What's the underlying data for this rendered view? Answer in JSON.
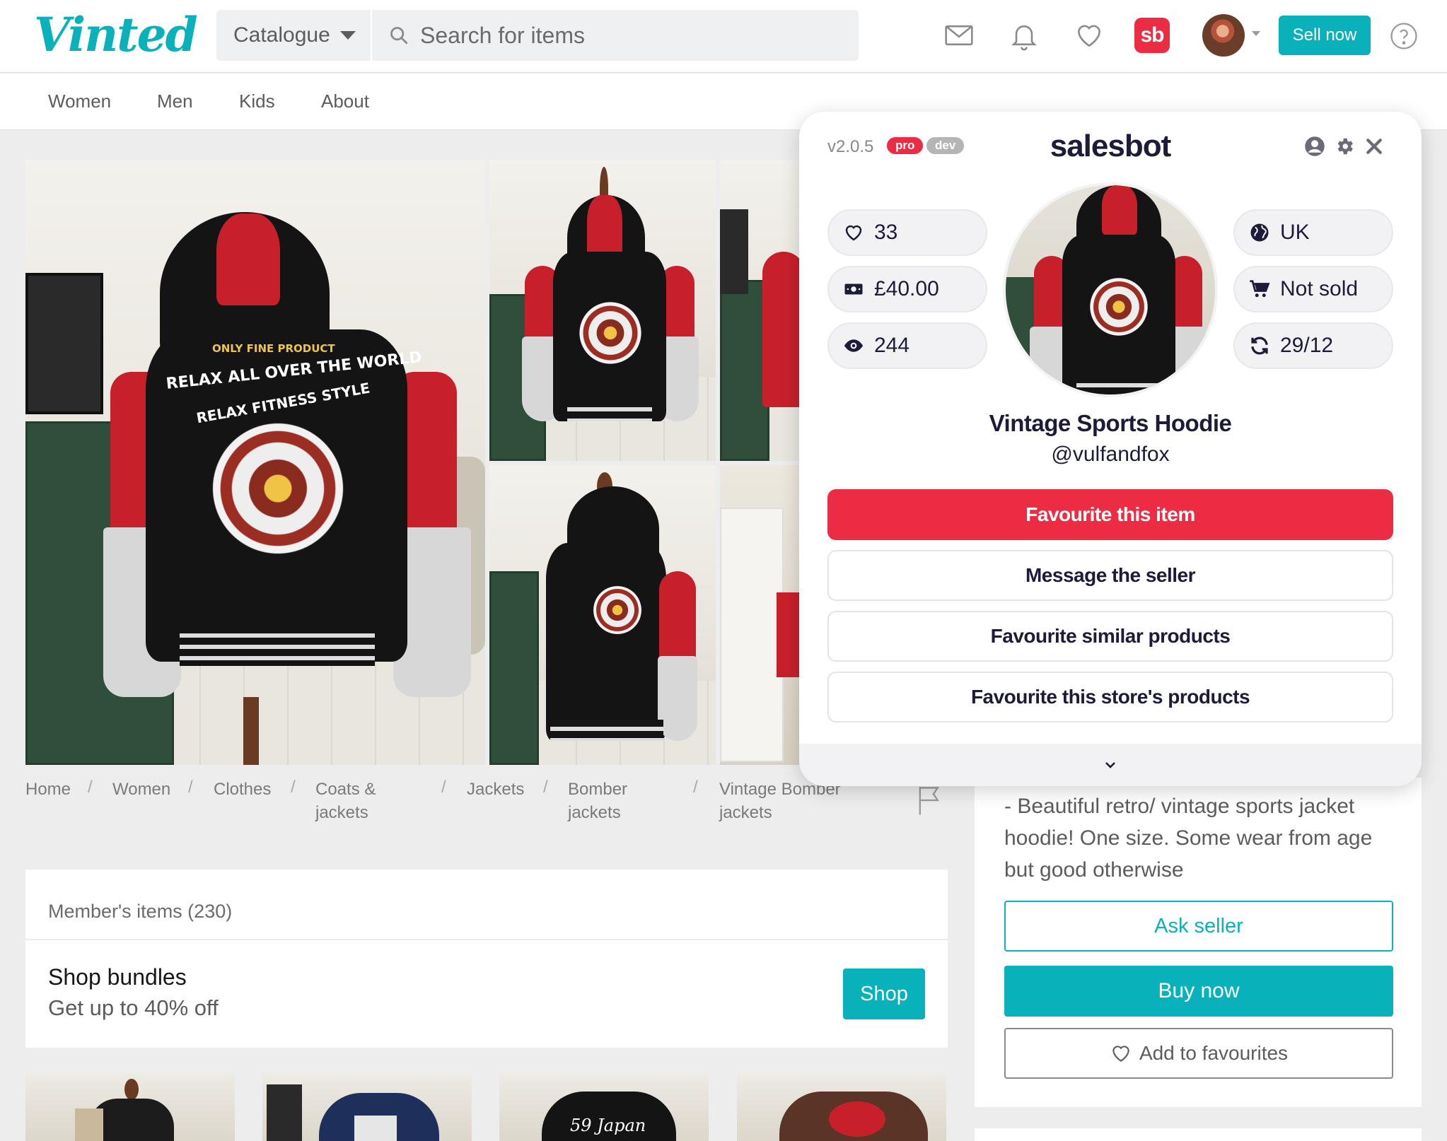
{
  "header": {
    "logo": "Vinted",
    "catalogue_label": "Catalogue",
    "search_placeholder": "Search for items",
    "icons": [
      "mail-icon",
      "bell-icon",
      "heart-icon",
      "salesbot-icon",
      "avatar",
      "help-icon"
    ],
    "salesbot_badge": "sb",
    "sell_label": "Sell now"
  },
  "nav": {
    "items": [
      "Women",
      "Men",
      "Kids",
      "About"
    ]
  },
  "breadcrumb": [
    {
      "line1": "Home",
      "line2": ""
    },
    {
      "line1": "Women",
      "line2": ""
    },
    {
      "line1": "Clothes",
      "line2": ""
    },
    {
      "line1": "Coats &",
      "line2": "jackets"
    },
    {
      "line1": "Jackets",
      "line2": ""
    },
    {
      "line1": "Bomber",
      "line2": "jackets"
    },
    {
      "line1": "Vintage Bomber",
      "line2": "jackets"
    }
  ],
  "product_print": {
    "line1": "ONLY FINE PRODUCT",
    "line2": "RELAX ALL OVER THE WORLD",
    "line3": "RELAX FITNESS STYLE"
  },
  "members": {
    "title": "Member's items (230)",
    "bundles_title": "Shop bundles",
    "bundles_sub": "Get up to 40% off",
    "shop_label": "Shop",
    "thumb_text": "59 Japan"
  },
  "sidebar": {
    "description": "- Beautiful retro/ vintage sports jacket hoodie! One size. Some wear from age but good otherwise",
    "ask_seller": "Ask seller",
    "buy_now": "Buy now",
    "add_favourites": "Add to favourites"
  },
  "salesbot": {
    "version": "v2.0.5",
    "pill_pro": "pro",
    "pill_dev": "dev",
    "logo": "salesbot",
    "stats_left": [
      {
        "icon": "heart-icon",
        "value": "33"
      },
      {
        "icon": "money-icon",
        "value": "£40.00"
      },
      {
        "icon": "eye-icon",
        "value": "244"
      }
    ],
    "stats_right": [
      {
        "icon": "globe-icon",
        "value": "UK"
      },
      {
        "icon": "cart-icon",
        "value": "Not sold"
      },
      {
        "icon": "refresh-icon",
        "value": "29/12"
      }
    ],
    "title": "Vintage Sports Hoodie",
    "seller": "@vulfandfox",
    "buttons": {
      "favourite_item": "Favourite this item",
      "message_seller": "Message the seller",
      "favourite_similar": "Favourite similar products",
      "favourite_store": "Favourite this store's products"
    }
  },
  "colors": {
    "brand": "#09b1ba",
    "salesbot_red": "#eb2c43",
    "salesbot_navy": "#1c1c3a"
  }
}
